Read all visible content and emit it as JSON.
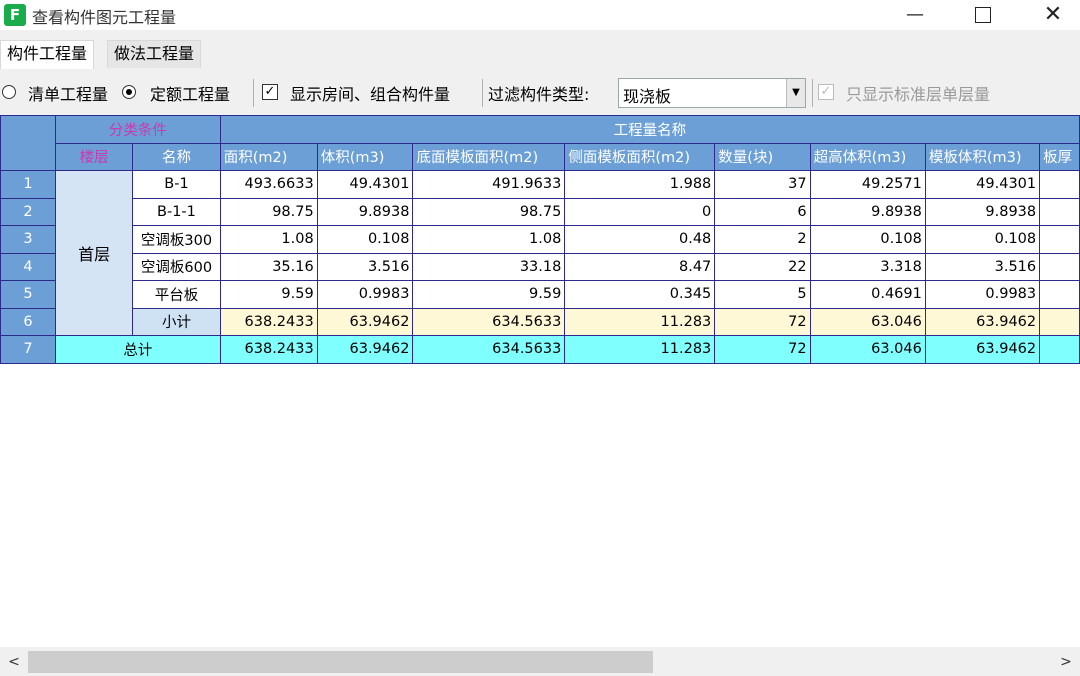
{
  "window": {
    "icon_letter": "F",
    "title": "查看构件图元工程量",
    "minimize": "—",
    "close": "✕"
  },
  "tabs": [
    {
      "label": "构件工程量",
      "active": true
    },
    {
      "label": "做法工程量",
      "active": false
    }
  ],
  "toolbar": {
    "radio_bill": {
      "label": "清单工程量",
      "checked": false
    },
    "radio_quota": {
      "label": "定额工程量",
      "checked": true
    },
    "show_room": {
      "label": "显示房间、组合构件量",
      "checked": true
    },
    "filter_label": "过滤构件类型:",
    "filter_value": "现浇板",
    "std_floor": {
      "label": "只显示标准层单层量",
      "checked": true,
      "disabled": true
    }
  },
  "grid": {
    "group_header_left": "分类条件",
    "group_header_right": "工程量名称",
    "columns": [
      "楼层",
      "名称",
      "面积(m2)",
      "体积(m3)",
      "底面模板面积(m2)",
      "侧面模板面积(m2)",
      "数量(块)",
      "超高体积(m3)",
      "模板体积(m3)",
      "板厚"
    ],
    "floor": "首层",
    "rows": [
      {
        "num": "1",
        "name": "B-1",
        "values": [
          "493.6633",
          "49.4301",
          "491.9633",
          "1.988",
          "37",
          "49.2571",
          "49.4301"
        ]
      },
      {
        "num": "2",
        "name": "B-1-1",
        "values": [
          "98.75",
          "9.8938",
          "98.75",
          "0",
          "6",
          "9.8938",
          "9.8938"
        ]
      },
      {
        "num": "3",
        "name": "空调板300",
        "values": [
          "1.08",
          "0.108",
          "1.08",
          "0.48",
          "2",
          "0.108",
          "0.108"
        ]
      },
      {
        "num": "4",
        "name": "空调板600",
        "values": [
          "35.16",
          "3.516",
          "33.18",
          "8.47",
          "22",
          "3.318",
          "3.516"
        ]
      },
      {
        "num": "5",
        "name": "平台板",
        "values": [
          "9.59",
          "0.9983",
          "9.59",
          "0.345",
          "5",
          "0.4691",
          "0.9983"
        ]
      }
    ],
    "subtotal": {
      "num": "6",
      "name": "小计",
      "values": [
        "638.2433",
        "63.9462",
        "634.5633",
        "11.283",
        "72",
        "63.046",
        "63.9462"
      ]
    },
    "total": {
      "num": "7",
      "name": "总计",
      "values": [
        "638.2433",
        "63.9462",
        "634.5633",
        "11.283",
        "72",
        "63.046",
        "63.9462"
      ]
    }
  },
  "scroll": {
    "left": "<",
    "right": ">",
    "position_fraction": 0.58
  }
}
